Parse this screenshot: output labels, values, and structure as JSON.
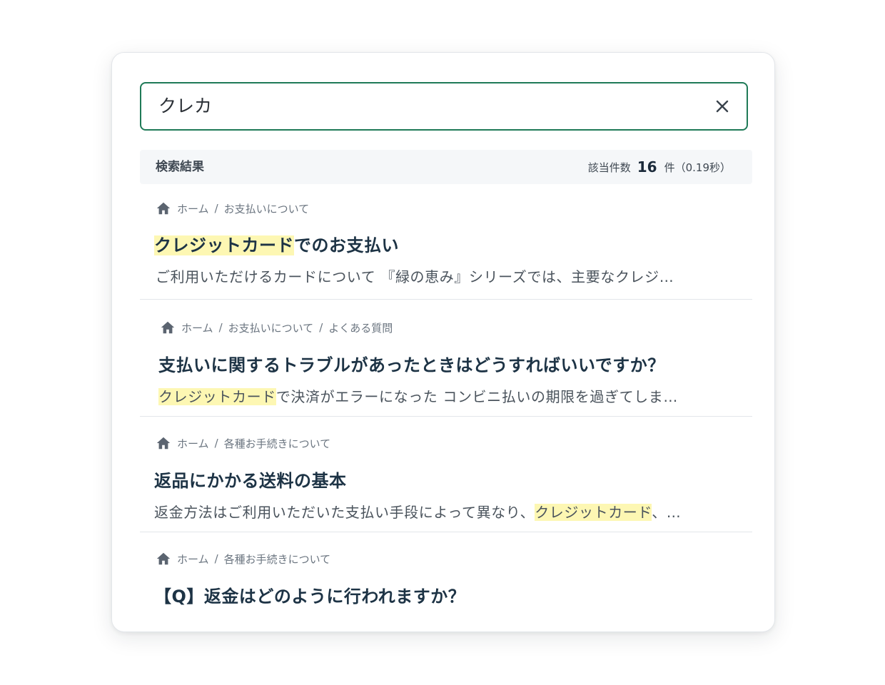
{
  "search": {
    "query": "クレカ",
    "clear_icon": "close-icon"
  },
  "results_header": {
    "title": "検索結果",
    "count_label": "該当件数",
    "count": "16",
    "count_unit": "件（0.19秒）"
  },
  "results": [
    {
      "breadcrumb": [
        "ホーム",
        "お支払いについて"
      ],
      "title_highlight": "クレジットカード",
      "title_rest": "でのお支払い",
      "snippet": "ご利用いただけるカードについて 『緑の恵み』シリーズでは、主要なクレジ…"
    },
    {
      "breadcrumb": [
        "ホーム",
        "お支払いについて",
        "よくある質問"
      ],
      "title": "支払いに関するトラブルがあったときはどうすればいいですか？",
      "snippet_highlight": "クレジットカード",
      "snippet_rest": "で決済がエラーになった コンビニ払いの期限を過ぎてしま…"
    },
    {
      "breadcrumb": [
        "ホーム",
        "各種お手続きについて"
      ],
      "title": "返品にかかる送料の基本",
      "snippet_pre": "返金方法はご利用いただいた支払い手段によって異なり、",
      "snippet_highlight": "クレジットカード",
      "snippet_post": "、…"
    },
    {
      "breadcrumb": [
        "ホーム",
        "各種お手続きについて"
      ],
      "title": "【Q】返金はどのように行われますか？"
    }
  ],
  "colors": {
    "accent_border": "#1f7a57",
    "highlight": "#fdf7b3",
    "title_text": "#1d3345"
  }
}
